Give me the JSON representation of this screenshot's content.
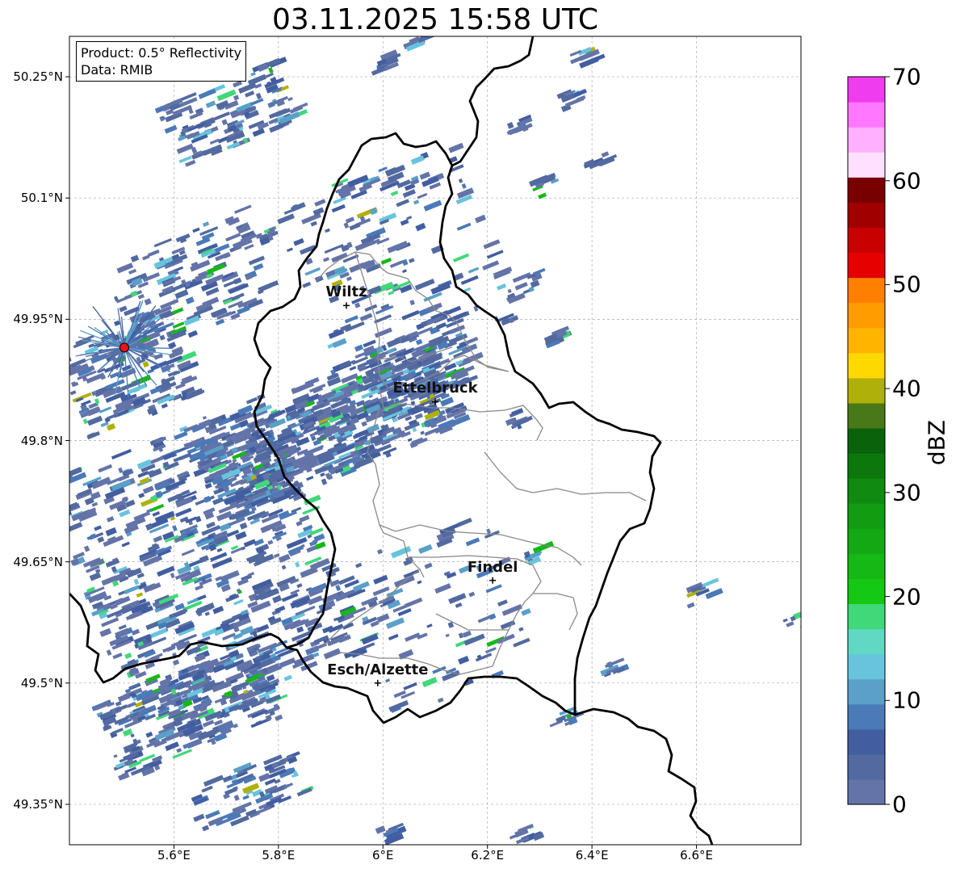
{
  "title": "03.11.2025 15:58 UTC",
  "info": {
    "product": "Product: 0.5° Reflectivity",
    "data": "Data: RMIB"
  },
  "lat_labels": [
    "50.25°N",
    "50.1°N",
    "49.95°N",
    "49.8°N",
    "49.65°N",
    "49.5°N",
    "49.35°N"
  ],
  "lat_values": [
    50.25,
    50.1,
    49.95,
    49.8,
    49.65,
    49.5,
    49.35
  ],
  "lon_labels": [
    "5.6°E",
    "5.8°E",
    "6°E",
    "6.2°E",
    "6.4°E",
    "6.6°E"
  ],
  "lon_values": [
    5.6,
    5.8,
    6.0,
    6.2,
    6.4,
    6.6
  ],
  "extent": {
    "lon_min": 5.4,
    "lon_max": 6.8,
    "lat_min": 49.3,
    "lat_max": 50.3
  },
  "cities": [
    {
      "name": "Wiltz",
      "lon": 5.93,
      "lat": 49.967
    },
    {
      "name": "Ettelbruck",
      "lon": 6.1,
      "lat": 49.848
    },
    {
      "name": "Findel",
      "lon": 6.21,
      "lat": 49.627
    },
    {
      "name": "Esch/Alzette",
      "lon": 5.99,
      "lat": 49.5
    }
  ],
  "radar_site": {
    "lon": 5.505,
    "lat": 49.915,
    "color": "#e8141a"
  },
  "colorbar": {
    "label": "dBZ",
    "min": 0,
    "max": 70,
    "tick_labels": [
      "0",
      "10",
      "20",
      "30",
      "40",
      "50",
      "60",
      "70"
    ],
    "tick_values": [
      0,
      10,
      20,
      30,
      40,
      50,
      60,
      70
    ],
    "colors": [
      "#6474a8",
      "#526aa0",
      "#425ea0",
      "#4a7ab8",
      "#5aa0c8",
      "#68c4dc",
      "#60d8c4",
      "#40d878",
      "#14c814",
      "#16b816",
      "#14a814",
      "#129c12",
      "#108a10",
      "#0c780c",
      "#0a620a",
      "#487818",
      "#b0b00a",
      "#ffd800",
      "#ffb400",
      "#ff9c00",
      "#ff8000",
      "#e60000",
      "#c80000",
      "#a00000",
      "#780000",
      "#ffe0ff",
      "#ffb0ff",
      "#ff78ff",
      "#ee3cee"
    ]
  }
}
